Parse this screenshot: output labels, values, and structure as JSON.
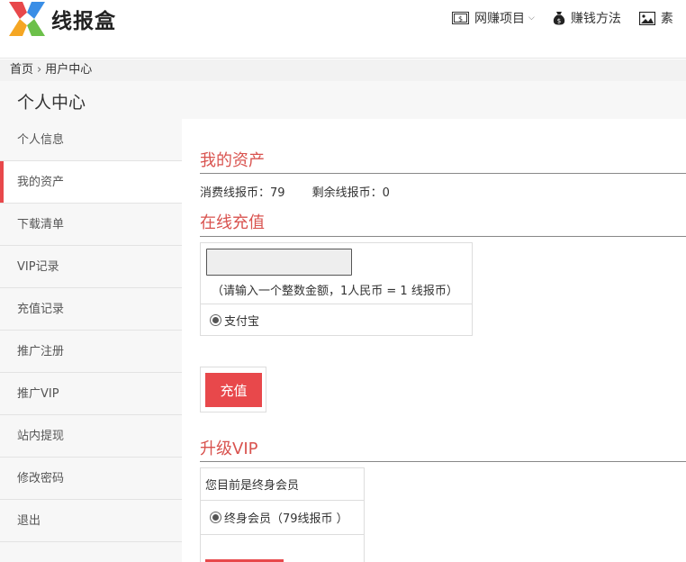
{
  "site": {
    "logo_text": "线报盒"
  },
  "nav": {
    "items": [
      {
        "label": "网赚项目",
        "icon": "money-bill-icon",
        "has_caret": true
      },
      {
        "label": "赚钱方法",
        "icon": "money-bag-icon"
      },
      {
        "label": "素",
        "icon": "image-icon"
      }
    ]
  },
  "breadcrumb": {
    "home": "首页",
    "separator": "›",
    "current": "用户中心"
  },
  "page_title": "个人中心",
  "sidebar": {
    "items": [
      {
        "label": "个人信息"
      },
      {
        "label": "我的资产",
        "active": true
      },
      {
        "label": "下载清单"
      },
      {
        "label": "VIP记录"
      },
      {
        "label": "充值记录"
      },
      {
        "label": "推广注册"
      },
      {
        "label": "推广VIP"
      },
      {
        "label": "站内提现"
      },
      {
        "label": "修改密码"
      },
      {
        "label": "退出"
      }
    ]
  },
  "assets": {
    "title": "我的资产",
    "spent_label": "消费线报币：",
    "spent_value": "79",
    "remaining_label": "剩余线报币：",
    "remaining_value": "0"
  },
  "recharge": {
    "title": "在线充值",
    "amount_value": "",
    "hint": "（请输入一个整数金额，1人民币 = 1 线报币）",
    "payment_option": "支付宝",
    "button_label": "充值"
  },
  "vip": {
    "title": "升级VIP",
    "status_text": "您目前是终身会员",
    "option_label": "终身会员（79线报币 ）"
  },
  "colors": {
    "accent": "#e8484b",
    "section_title": "#d9534f"
  }
}
